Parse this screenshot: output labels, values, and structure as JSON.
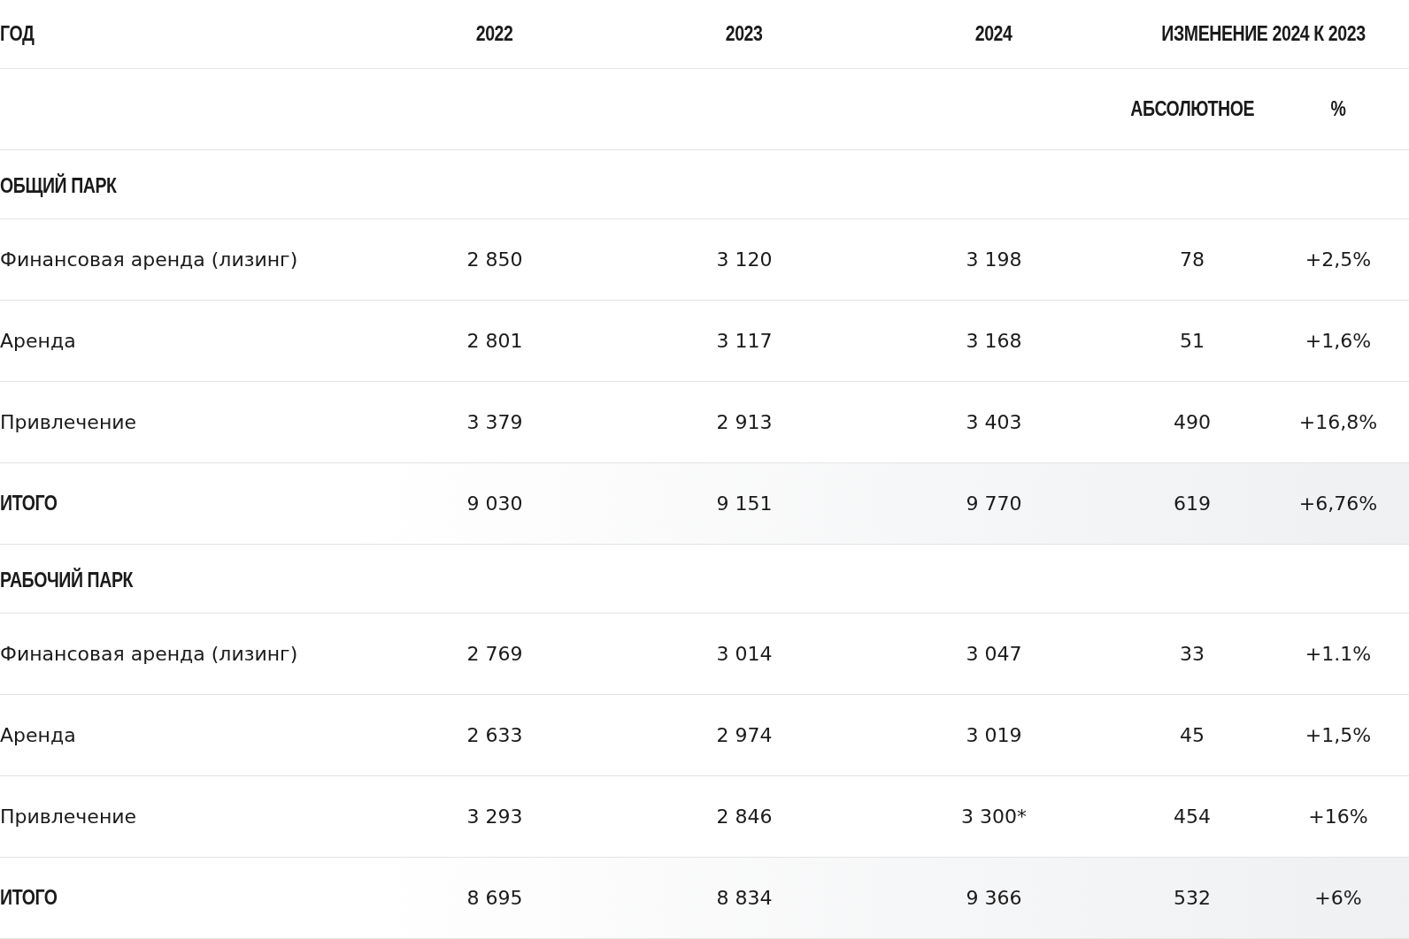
{
  "header": {
    "label": "ГОД",
    "years": [
      "2022",
      "2023",
      "2024"
    ],
    "change": "ИЗМЕНЕНИЕ 2024 К 2023"
  },
  "subheader": [
    "АБСОЛЮТНОЕ",
    "%"
  ],
  "sections": [
    {
      "title": "ОБЩИЙ ПАРК",
      "rows": [
        {
          "kind": "data",
          "label": "Финансовая аренда (лизинг)",
          "values": [
            "2 850",
            "3 120",
            "3 198",
            "78",
            "+2,5%"
          ]
        },
        {
          "kind": "data",
          "label": "Аренда",
          "values": [
            "2 801",
            "3 117",
            "3 168",
            "51",
            "+1,6%"
          ]
        },
        {
          "kind": "data",
          "label": "Привлечение",
          "values": [
            "3 379",
            "2 913",
            "3 403",
            "490",
            "+16,8%"
          ]
        },
        {
          "kind": "total",
          "label": "ИТОГО",
          "values": [
            "9 030",
            "9 151",
            "9 770",
            "619",
            "+6,76%"
          ]
        }
      ]
    },
    {
      "title": "РАБОЧИЙ ПАРК",
      "rows": [
        {
          "kind": "data",
          "label": "Финансовая аренда (лизинг)",
          "values": [
            "2 769",
            "3 014",
            "3 047",
            "33",
            "+1.1%"
          ]
        },
        {
          "kind": "data",
          "label": "Аренда",
          "values": [
            "2 633",
            "2 974",
            "3 019",
            "45",
            "+1,5%"
          ]
        },
        {
          "kind": "data",
          "label": "Привлечение",
          "values": [
            "3 293",
            "2 846",
            "3 300*",
            "454",
            "+16%"
          ]
        },
        {
          "kind": "total",
          "label": "ИТОГО",
          "values": [
            "8 695",
            "8 834",
            "9 366",
            "532",
            "+6%"
          ]
        }
      ]
    }
  ]
}
